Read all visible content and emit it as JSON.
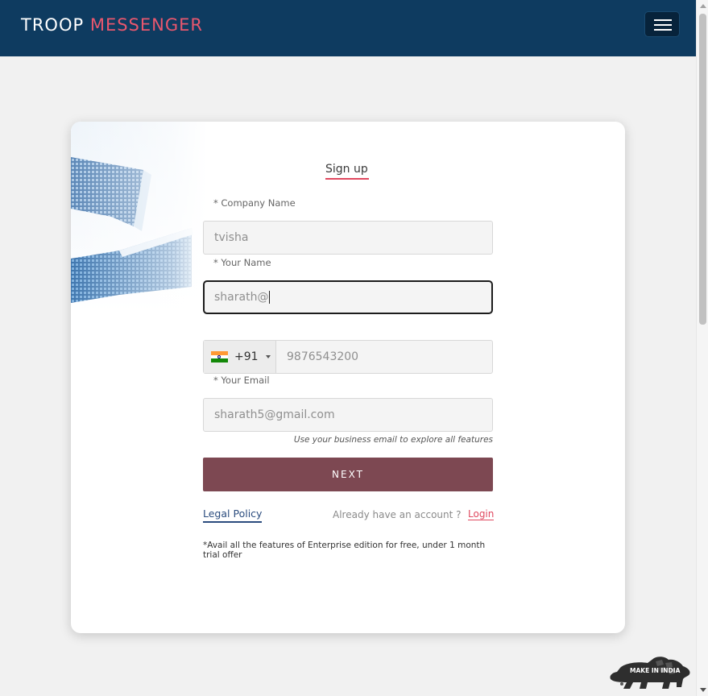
{
  "navbar": {
    "brand_part1": "TROOP",
    "brand_part2": "MESSENGER",
    "menu_icon": "hamburger-menu-icon"
  },
  "form": {
    "title": "Sign up",
    "company_label": "* Company Name",
    "company_value": "tvisha",
    "name_label": "* Your Name",
    "name_value": "sharath@",
    "phone_country_code": "+91",
    "phone_flag": "india-flag-icon",
    "phone_value": "9876543200",
    "email_label": "* Your Email",
    "email_value": "sharath5@gmail.com",
    "email_hint": "Use your business email to explore all features",
    "next_label": "NEXT",
    "legal_link": "Legal Policy",
    "have_account": "Already have an account ?",
    "login_link": "Login",
    "trial_note": "*Avail all the features of Enterprise edition for free, under 1 month trial offer"
  },
  "badge": {
    "text": "MAKE IN INDIA"
  },
  "colors": {
    "navbar": "#0e3b60",
    "accent": "#e8576e",
    "next_button": "#7d4852",
    "link": "#2b4c7e"
  }
}
